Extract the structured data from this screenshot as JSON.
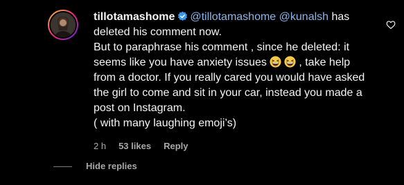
{
  "comment": {
    "username": "tillotamashome",
    "mention_self": "@tillotamashome",
    "mention_other": "@kunalsh",
    "text_line1_after": " has deleted his comment now.",
    "text_line2_before": "But to paraphrase his comment , since he deleted: it seems like you have anxiety issues ",
    "text_line2_after": ", take help from a doctor. If you really cared you would have asked the girl to come and sit in your car, instead you made a post on Instagram.",
    "text_line3": "( with many laughing emoji’s)",
    "emoji_name": "grinning-squinting-face",
    "time": "2 h",
    "likes": "53 likes",
    "reply_label": "Reply"
  },
  "replies": {
    "hide_label": "Hide replies"
  },
  "colors": {
    "background": "#000000",
    "text": "#f5f5f5",
    "mention": "#8eb4e8",
    "muted": "#a8a8a8",
    "verified": "#3897f0"
  },
  "icons": {
    "verified": "verified-badge-icon",
    "like": "heart-outline-icon"
  }
}
